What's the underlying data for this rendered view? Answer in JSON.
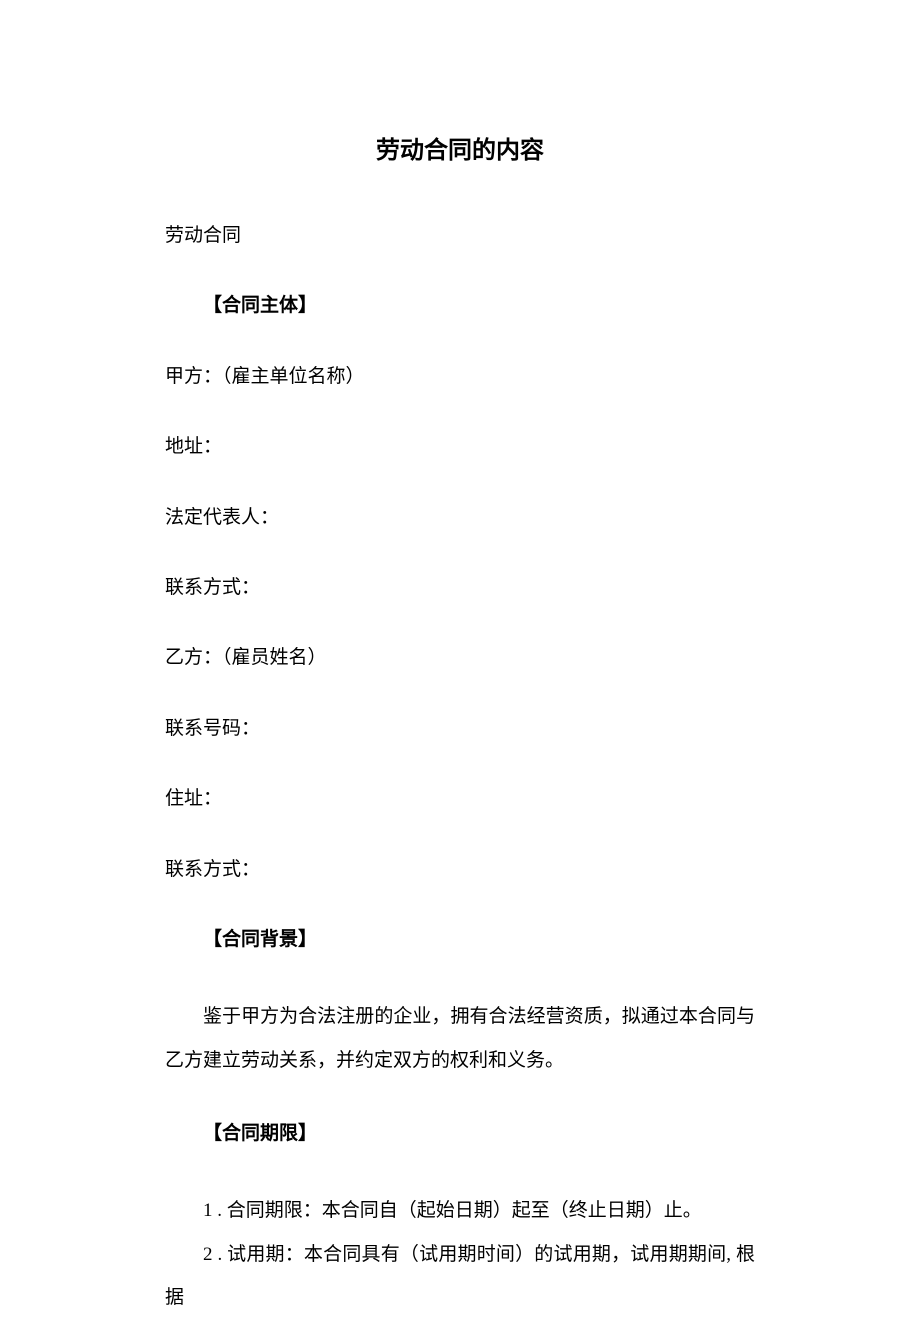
{
  "title": "劳动合同的内容",
  "lines": {
    "l1": "劳动合同",
    "l2": "【合同主体】",
    "l3": "甲方：（雇主单位名称）",
    "l4": "地址：",
    "l5": "法定代表人：",
    "l6": "联系方式：",
    "l7": "乙方：（雇员姓名）",
    "l8": "联系号码：",
    "l9": "住址：",
    "l10": "联系方式：",
    "l11": "【合同背景】",
    "l12": "鉴于甲方为合法注册的企业，拥有合法经营资质，拟通过本合同与乙方建立劳动关系，并约定双方的权利和义务。",
    "l13": "【合同期限】",
    "l14": "1 . 合同期限：本合同自（起始日期）起至（终止日期）止。",
    "l15": "2 . 试用期：本合同具有（试用期时间）的试用期，试用期期间, 根据"
  }
}
